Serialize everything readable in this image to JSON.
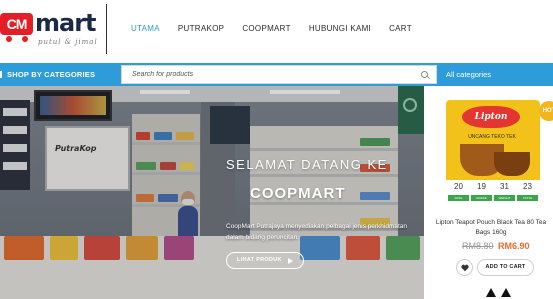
{
  "brand": {
    "logo_mark": "CM",
    "logo_word": "mart",
    "tagline": "putul & jimal"
  },
  "nav": {
    "items": [
      {
        "label": "UTAMA",
        "active": true
      },
      {
        "label": "PUTRAKOP",
        "active": false
      },
      {
        "label": "COOPMART",
        "active": false
      },
      {
        "label": "HUBUNGI KAMI",
        "active": false
      },
      {
        "label": "CART",
        "active": false
      }
    ]
  },
  "category_bar": {
    "toggle_label": "SHOP BY CATEGORIES",
    "search_placeholder": "Search for products",
    "search_value": "",
    "category_select": "All categories",
    "background_color": "#2d9cd8"
  },
  "hero": {
    "title_line1": "SELAMAT DATANG KE",
    "title_line2": "COOPMART",
    "description": "CoopMart Putrajaya menyediakan pelbagai jenis perkhidmatan dalam bidang peruncitan.",
    "button_label": "LIHAT PRODUK",
    "store_sign": "PutraKop"
  },
  "product": {
    "badge": "HOT",
    "brand_label": "Lipton",
    "package_line": "UNCANG TEKO TEK",
    "package_numbers": [
      "20",
      "19",
      "31",
      "23"
    ],
    "package_tags": [
      "DATE",
      "GRADE",
      "WEIGHT",
      "TASTE"
    ],
    "name": "Lipton Teapot Pouch Black Tea 80 Tea Bags 160g",
    "price_old": "RM8.80",
    "price_new": "RM6.90",
    "add_to_cart_label": "ADD TO CART"
  },
  "colors": {
    "accent": "#2e9ad8",
    "brand_red": "#e21f26",
    "price_sale": "#f0692a"
  }
}
